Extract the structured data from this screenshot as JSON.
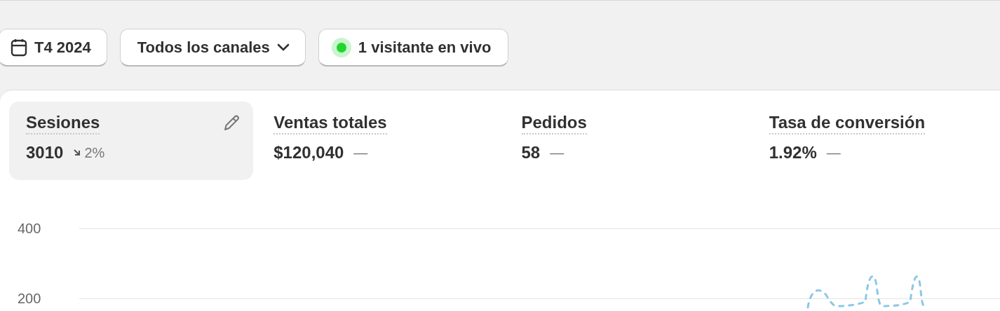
{
  "filters": [
    {
      "kind": "date",
      "label": "T4 2024"
    },
    {
      "kind": "dropdown",
      "label": "Todos los canales"
    },
    {
      "kind": "live",
      "label": "1 visitante en vivo"
    }
  ],
  "metrics": [
    {
      "title": "Sesiones",
      "value": "3010",
      "kind": "down",
      "change": "2%",
      "selected": true
    },
    {
      "title": "Ventas totales",
      "value": "$120,040",
      "kind": "flat",
      "change": "—",
      "selected": false
    },
    {
      "title": "Pedidos",
      "value": "58",
      "kind": "flat",
      "change": "—",
      "selected": false
    },
    {
      "title": "Tasa de conversión",
      "value": "1.92%",
      "kind": "flat",
      "change": "—",
      "selected": false
    }
  ],
  "chart": {
    "y_axis_labels": [
      "400",
      "200"
    ]
  }
}
